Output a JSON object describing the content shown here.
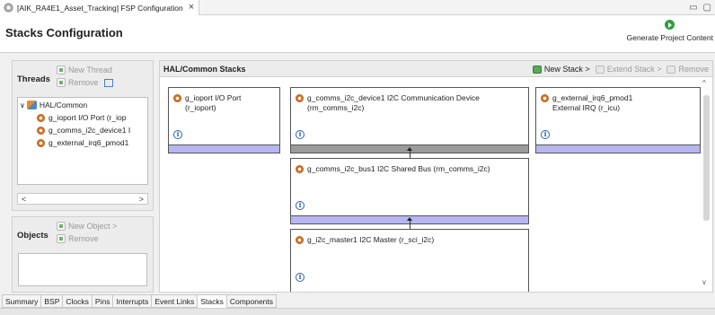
{
  "editor": {
    "tab_title": "[AIK_RA4E1_Asset_Tracking] FSP Configuration",
    "close_glyph": "×",
    "minimize_glyph": "▭",
    "maximize_glyph": "▢"
  },
  "header": {
    "title": "Stacks Configuration",
    "generate_label": "Generate Project Content",
    "generate_icon": "play-circle-icon"
  },
  "threads": {
    "title": "Threads",
    "new_thread": "New Thread",
    "remove": "Remove",
    "tree": [
      {
        "label": "HAL/Common",
        "expanded": true,
        "icon": "hal-icon"
      },
      {
        "label": "g_ioport I/O Port (r_iop",
        "icon": "module-icon"
      },
      {
        "label": "g_comms_i2c_device1 I",
        "icon": "module-icon"
      },
      {
        "label": "g_external_irq6_pmod1",
        "icon": "module-icon"
      }
    ],
    "expand_glyph": "∨",
    "scroll_left": "<",
    "scroll_right": ">"
  },
  "objects": {
    "title": "Objects",
    "new_object": "New Object >",
    "remove": "Remove"
  },
  "stacks": {
    "title": "HAL/Common Stacks",
    "new_stack": "New Stack >",
    "extend_stack": "Extend Stack >",
    "remove": "Remove",
    "info_glyph": "i",
    "modules": [
      {
        "line1": "g_ioport I/O Port",
        "line2": "(r_ioport)"
      },
      {
        "line1": "g_comms_i2c_device1 I2C Communication Device",
        "line2": "(rm_comms_i2c)"
      },
      {
        "line1": "g_external_irq6_pmod1",
        "line2": "External IRQ (r_icu)"
      },
      {
        "line1": "g_comms_i2c_bus1 I2C Shared Bus (rm_comms_i2c)",
        "line2": ""
      },
      {
        "line1": "g_i2c_master1 I2C Master (r_sci_i2c)",
        "line2": ""
      }
    ],
    "scroll_up": "^",
    "scroll_down": "v"
  },
  "bottom_tabs": [
    "Summary",
    "BSP",
    "Clocks",
    "Pins",
    "Interrupts",
    "Event Links",
    "Stacks",
    "Components"
  ],
  "active_tab": "Stacks",
  "colors": {
    "module_bar": "#b7b6f0",
    "module_bar_selected": "#9b9b9b",
    "generate_icon": "#2f9e3e"
  }
}
